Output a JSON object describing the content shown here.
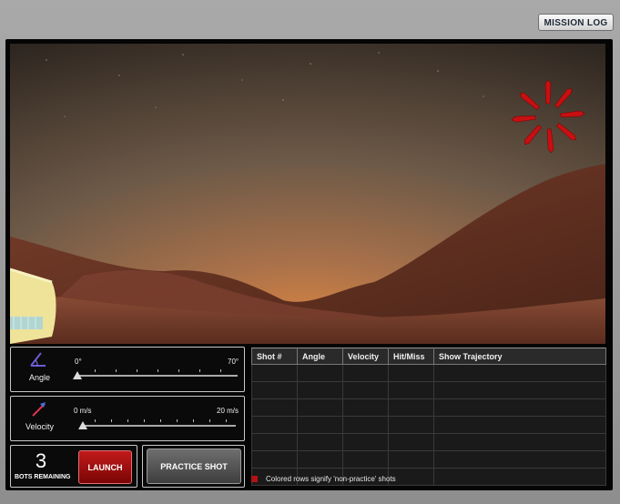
{
  "header": {
    "mission_log_label": "MISSION LOG"
  },
  "angle": {
    "label": "Angle",
    "min_label": "0°",
    "max_label": "70°",
    "value_fraction": 0.0,
    "icon": "angle-icon"
  },
  "velocity": {
    "label": "Velocity",
    "min_label": "0 m/s",
    "max_label": "20 m/s",
    "value_fraction": 0.0,
    "icon": "velocity-arrow-icon"
  },
  "bots": {
    "count": "3",
    "label": "BOTS REMAINING"
  },
  "buttons": {
    "launch": "LAUNCH",
    "practice": "PRACTICE SHOT"
  },
  "table": {
    "headers": [
      "Shot #",
      "Angle",
      "Velocity",
      "Hit/Miss",
      "Show Trajectory"
    ],
    "rows": [
      [],
      [],
      [],
      [],
      [],
      [],
      []
    ]
  },
  "legend": {
    "text": "Colored rows signify 'non-practice' shots",
    "color": "#b21212"
  },
  "colors": {
    "accent_red": "#b21212",
    "launch_red": "#9e0e0e",
    "sky": "#6b5a48",
    "ground": "#8a4a32"
  }
}
